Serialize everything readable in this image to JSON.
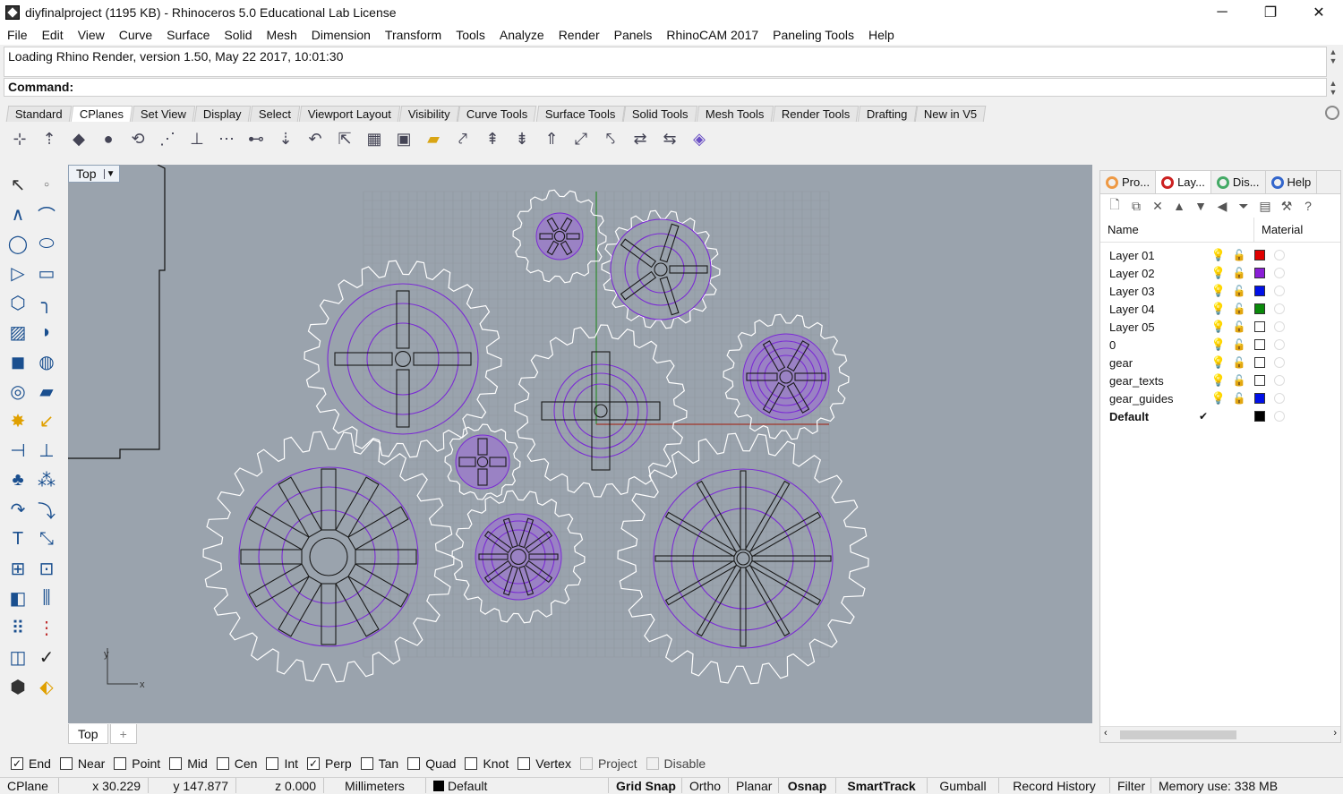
{
  "window": {
    "title": "diyfinalproject (1195 KB) - Rhinoceros 5.0 Educational Lab License",
    "minimize_icon": "minimize-icon",
    "maximize_icon": "restore-icon",
    "close_icon": "close-icon"
  },
  "menu": [
    "File",
    "Edit",
    "View",
    "Curve",
    "Surface",
    "Solid",
    "Mesh",
    "Dimension",
    "Transform",
    "Tools",
    "Analyze",
    "Render",
    "Panels",
    "RhinoCAM 2017",
    "Paneling Tools",
    "Help"
  ],
  "command": {
    "history": "Loading Rhino Render, version 1.50, May 22 2017, 10:01:30",
    "prompt": "Command:",
    "value": ""
  },
  "toolbar_tabs": [
    "Standard",
    "CPlanes",
    "Set View",
    "Display",
    "Select",
    "Viewport Layout",
    "Visibility",
    "Curve Tools",
    "Surface Tools",
    "Solid Tools",
    "Mesh Tools",
    "Render Tools",
    "Drafting",
    "New in V5"
  ],
  "active_tab": "CPlanes",
  "viewport": {
    "name": "Top",
    "tabs": [
      "Top",
      "+"
    ],
    "axis_x": "x",
    "axis_y": "y",
    "colors": {
      "background": "#9aa3ad",
      "grid": "#8f979f",
      "gear_outline": "#ffffff",
      "guide": "#7b2bd4",
      "x_axis": "#a0342a",
      "y_axis": "#2e8b2e"
    }
  },
  "panel": {
    "tabs": [
      "Pro...",
      "Lay...",
      "Dis...",
      "Help"
    ],
    "columns": {
      "name": "Name",
      "material": "Material"
    },
    "layers": [
      {
        "name": "Layer 01",
        "color": "#e00000",
        "current": false
      },
      {
        "name": "Layer 02",
        "color": "#8a1ed6",
        "current": false
      },
      {
        "name": "Layer 03",
        "color": "#0010e8",
        "current": false
      },
      {
        "name": "Layer 04",
        "color": "#0a8a0a",
        "current": false
      },
      {
        "name": "Layer 05",
        "color": "#ffffff",
        "current": false
      },
      {
        "name": "0",
        "color": "#ffffff",
        "current": false
      },
      {
        "name": "gear",
        "color": "#ffffff",
        "current": false
      },
      {
        "name": "gear_texts",
        "color": "#ffffff",
        "current": false
      },
      {
        "name": "gear_guides",
        "color": "#0010e8",
        "current": false
      },
      {
        "name": "Default",
        "color": "#000000",
        "current": true
      }
    ],
    "current_mark": "✔"
  },
  "osnaps": [
    {
      "label": "End",
      "checked": true
    },
    {
      "label": "Near",
      "checked": false
    },
    {
      "label": "Point",
      "checked": false
    },
    {
      "label": "Mid",
      "checked": false
    },
    {
      "label": "Cen",
      "checked": false
    },
    {
      "label": "Int",
      "checked": false
    },
    {
      "label": "Perp",
      "checked": true
    },
    {
      "label": "Tan",
      "checked": false
    },
    {
      "label": "Quad",
      "checked": false
    },
    {
      "label": "Knot",
      "checked": false
    },
    {
      "label": "Vertex",
      "checked": false
    },
    {
      "label": "Project",
      "checked": false,
      "disabled": true
    },
    {
      "label": "Disable",
      "checked": false,
      "disabled": true
    }
  ],
  "status": {
    "cplane": "CPlane",
    "x": "x 30.229",
    "y": "y 147.877",
    "z": "z 0.000",
    "units": "Millimeters",
    "layer": "Default",
    "grid_snap": "Grid Snap",
    "ortho": "Ortho",
    "planar": "Planar",
    "osnap": "Osnap",
    "smarttrack": "SmartTrack",
    "gumball": "Gumball",
    "record_history": "Record History",
    "filter": "Filter",
    "memory": "Memory use: 338 MB"
  }
}
